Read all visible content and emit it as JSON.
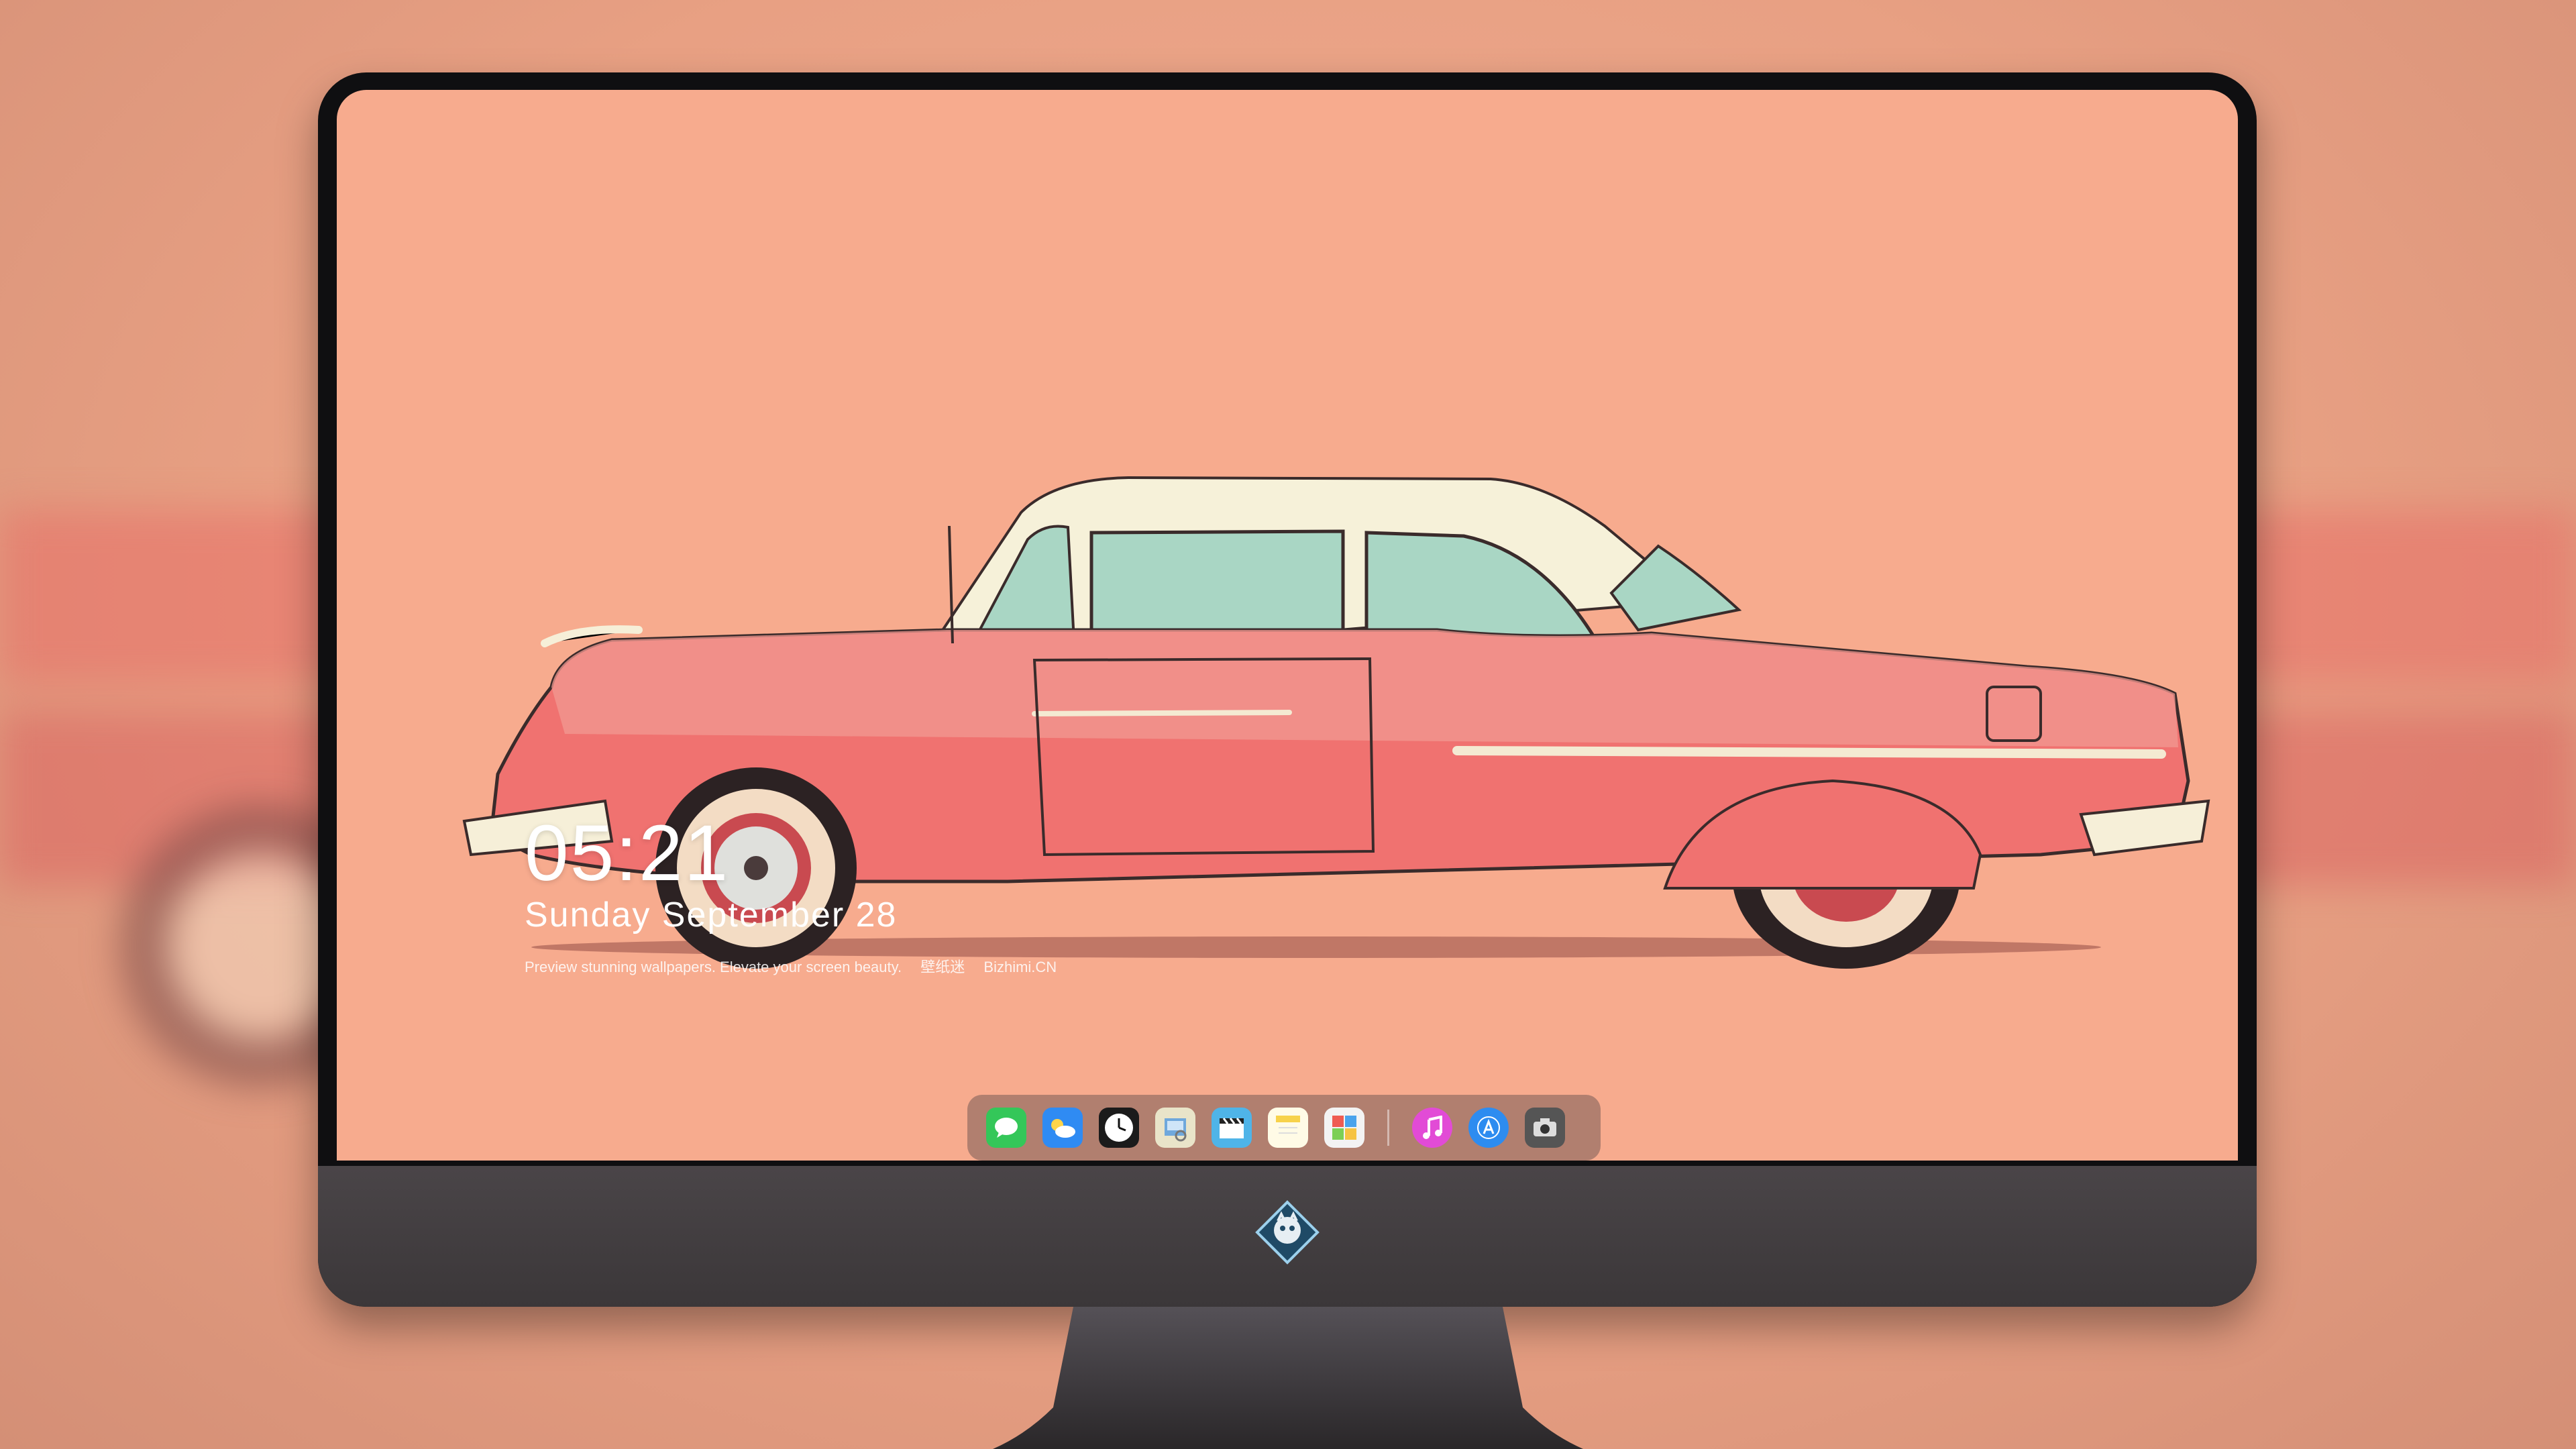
{
  "screen": {
    "clock": "05:21",
    "date": "Sunday September  28",
    "tagline": [
      "Preview stunning wallpapers. Elevate your screen beauty.",
      "壁纸迷",
      "Bizhimi.CN"
    ]
  },
  "dock": {
    "items": [
      {
        "name": "messages",
        "icon": "messages-icon",
        "color": "#34c759"
      },
      {
        "name": "weather",
        "icon": "weather-icon",
        "color": "#2f8bf3"
      },
      {
        "name": "clock",
        "icon": "clock-icon",
        "color": "#1b1b1b"
      },
      {
        "name": "preview",
        "icon": "preview-icon",
        "color": "#e9e4c9"
      },
      {
        "name": "clips",
        "icon": "clapperboard-icon",
        "color": "#4fb4e8"
      },
      {
        "name": "notes",
        "icon": "notes-icon",
        "color": "#f7e27a"
      },
      {
        "name": "photo-booth",
        "icon": "photo-booth-icon",
        "color": "#ef5b52"
      },
      {
        "name": "music",
        "icon": "music-icon",
        "color": "#e24bd6"
      },
      {
        "name": "app-store",
        "icon": "app-store-icon",
        "color": "#2d8cf0"
      },
      {
        "name": "camera",
        "icon": "camera-icon",
        "color": "#555555"
      }
    ]
  },
  "colors": {
    "wallpaper": "#f7ab8e",
    "car_body": "#f07270",
    "car_roof": "#f5f0d8",
    "monitor_bezel": "#0f0f11",
    "monitor_chin": "#3b3739"
  }
}
